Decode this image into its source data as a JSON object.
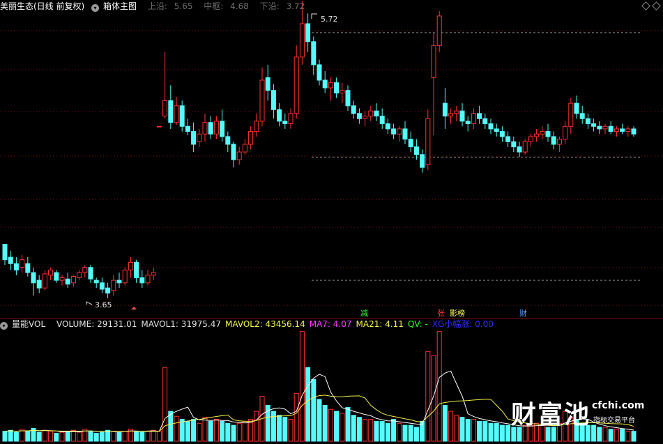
{
  "header": {
    "symbol": "美丽生态(日线 前复权)",
    "indicator": "箱体主图",
    "upper_label": "上沿:",
    "upper_value": "5.65",
    "mid_label": "中枢:",
    "mid_value": "4.68",
    "lower_label": "下沿:",
    "lower_value": "3.72"
  },
  "vol_header": {
    "name": "量能VOL",
    "items": [
      {
        "label": "VOLUME:",
        "value": "29131.01",
        "color": "#e0e0e0"
      },
      {
        "label": "MAVOL1:",
        "value": "31975.47",
        "color": "#e0e0e0"
      },
      {
        "label": "MAVOL2:",
        "value": "43456.14",
        "color": "#f5f54a"
      },
      {
        "label": "MA7:",
        "value": "4.07",
        "color": "#ff40ff"
      },
      {
        "label": "MA21:",
        "value": "4.11",
        "color": "#f5f54a"
      },
      {
        "label": "QV:",
        "value": "-",
        "color": "#30ff30"
      },
      {
        "label": "XG小幅涨:",
        "value": "0.00",
        "color": "#3030ff"
      }
    ]
  },
  "markers": [
    {
      "text": "减",
      "color": "#30ff30"
    },
    {
      "text": "张",
      "color": "#ff4040"
    },
    {
      "text": "影榜",
      "color": "#ffff60"
    },
    {
      "text": "财",
      "color": "#60a0ff"
    }
  ],
  "annotations": {
    "high": "5.72",
    "low": "3.65"
  },
  "watermark": {
    "logo": "财富池",
    "site": "cfchi.com",
    "tagline": "指标交易平台"
  },
  "colors": {
    "up": "#ff3232",
    "down": "#54fcfc",
    "grid": "#7a1010",
    "box": "#8a8a8a"
  },
  "chart_data": {
    "type": "candlestick",
    "x": "daily bars (approximate readings)",
    "price_levels": {
      "upper": 5.65,
      "mid": 4.68,
      "lower": 3.72
    },
    "ohlc": [
      [
        4.0,
        4.0,
        3.84,
        3.88
      ],
      [
        3.9,
        3.95,
        3.8,
        3.85
      ],
      [
        3.85,
        3.9,
        3.76,
        3.8
      ],
      [
        3.82,
        3.92,
        3.78,
        3.88
      ],
      [
        3.85,
        3.9,
        3.75,
        3.78
      ],
      [
        3.78,
        3.82,
        3.6,
        3.7
      ],
      [
        3.72,
        3.76,
        3.62,
        3.66
      ],
      [
        3.66,
        3.8,
        3.64,
        3.77
      ],
      [
        3.76,
        3.82,
        3.72,
        3.8
      ],
      [
        3.78,
        3.8,
        3.7,
        3.72
      ],
      [
        3.72,
        3.76,
        3.68,
        3.74
      ],
      [
        3.73,
        3.78,
        3.66,
        3.69
      ],
      [
        3.7,
        3.76,
        3.67,
        3.75
      ],
      [
        3.74,
        3.8,
        3.72,
        3.78
      ],
      [
        3.78,
        3.84,
        3.74,
        3.82
      ],
      [
        3.82,
        3.84,
        3.7,
        3.73
      ],
      [
        3.72,
        3.74,
        3.66,
        3.7
      ],
      [
        3.7,
        3.74,
        3.62,
        3.65
      ],
      [
        3.66,
        3.7,
        3.58,
        3.62
      ],
      [
        3.64,
        3.76,
        3.6,
        3.72
      ],
      [
        3.72,
        3.78,
        3.66,
        3.7
      ],
      [
        3.7,
        3.82,
        3.68,
        3.8
      ],
      [
        3.8,
        3.9,
        3.74,
        3.86
      ],
      [
        3.86,
        3.88,
        3.7,
        3.74
      ],
      [
        3.74,
        3.8,
        3.66,
        3.7
      ],
      [
        3.7,
        3.8,
        3.68,
        3.76
      ],
      [
        3.76,
        3.82,
        3.72,
        3.78
      ],
      [
        4.92,
        4.92,
        4.92,
        4.92
      ],
      [
        5.0,
        5.5,
        4.98,
        5.12
      ],
      [
        5.12,
        5.24,
        4.9,
        4.95
      ],
      [
        4.95,
        5.15,
        4.93,
        5.08
      ],
      [
        5.08,
        5.12,
        4.88,
        4.92
      ],
      [
        4.92,
        4.98,
        4.85,
        4.88
      ],
      [
        4.88,
        4.95,
        4.72,
        4.78
      ],
      [
        4.8,
        4.9,
        4.76,
        4.86
      ],
      [
        4.86,
        5.02,
        4.8,
        4.95
      ],
      [
        4.95,
        5.0,
        4.82,
        4.86
      ],
      [
        4.86,
        5.0,
        4.82,
        4.96
      ],
      [
        4.96,
        5.05,
        4.8,
        4.84
      ],
      [
        4.84,
        4.88,
        4.72,
        4.78
      ],
      [
        4.78,
        4.8,
        4.6,
        4.66
      ],
      [
        4.66,
        4.76,
        4.62,
        4.72
      ],
      [
        4.72,
        4.82,
        4.7,
        4.78
      ],
      [
        4.78,
        4.92,
        4.74,
        4.88
      ],
      [
        4.88,
        5.02,
        4.84,
        4.96
      ],
      [
        4.96,
        5.38,
        4.92,
        5.28
      ],
      [
        5.3,
        5.4,
        5.12,
        5.2
      ],
      [
        5.2,
        5.25,
        4.98,
        5.05
      ],
      [
        5.05,
        5.1,
        4.92,
        4.96
      ],
      [
        4.96,
        5.02,
        4.9,
        4.94
      ],
      [
        4.94,
        5.06,
        4.9,
        5.02
      ],
      [
        5.02,
        5.55,
        4.98,
        5.46
      ],
      [
        5.46,
        5.9,
        5.4,
        5.72
      ],
      [
        5.72,
        5.8,
        5.5,
        5.58
      ],
      [
        5.58,
        5.62,
        5.32,
        5.4
      ],
      [
        5.4,
        5.44,
        5.24,
        5.28
      ],
      [
        5.28,
        5.35,
        5.18,
        5.22
      ],
      [
        5.22,
        5.3,
        5.12,
        5.26
      ],
      [
        5.26,
        5.3,
        5.14,
        5.18
      ],
      [
        5.18,
        5.26,
        5.1,
        5.2
      ],
      [
        5.2,
        5.24,
        5.04,
        5.08
      ],
      [
        5.08,
        5.12,
        4.98,
        5.02
      ],
      [
        5.02,
        5.06,
        4.94,
        4.98
      ],
      [
        4.98,
        5.04,
        4.92,
        5.0
      ],
      [
        5.0,
        5.08,
        4.96,
        5.04
      ],
      [
        5.04,
        5.1,
        4.96,
        5.0
      ],
      [
        5.0,
        5.06,
        4.9,
        4.94
      ],
      [
        4.94,
        4.98,
        4.86,
        4.9
      ],
      [
        4.9,
        4.94,
        4.82,
        4.86
      ],
      [
        4.86,
        4.92,
        4.8,
        4.9
      ],
      [
        4.9,
        4.96,
        4.78,
        4.82
      ],
      [
        4.82,
        4.88,
        4.72,
        4.76
      ],
      [
        4.76,
        4.82,
        4.66,
        4.7
      ],
      [
        4.7,
        4.74,
        4.56,
        4.6
      ],
      [
        4.62,
        5.05,
        4.58,
        4.98
      ],
      [
        5.3,
        5.65,
        4.85,
        5.55
      ],
      [
        5.55,
        5.82,
        5.5,
        5.78
      ],
      [
        5.1,
        5.22,
        4.9,
        5.0
      ],
      [
        5.0,
        5.06,
        4.94,
        5.02
      ],
      [
        5.02,
        5.08,
        4.96,
        5.04
      ],
      [
        5.04,
        5.1,
        4.92,
        4.96
      ],
      [
        4.96,
        5.0,
        4.88,
        4.94
      ],
      [
        4.94,
        5.06,
        4.9,
        5.02
      ],
      [
        5.02,
        5.08,
        4.94,
        4.98
      ],
      [
        4.98,
        5.02,
        4.9,
        4.94
      ],
      [
        4.94,
        4.98,
        4.86,
        4.9
      ],
      [
        4.9,
        4.94,
        4.84,
        4.88
      ],
      [
        4.88,
        4.92,
        4.8,
        4.84
      ],
      [
        4.84,
        4.88,
        4.76,
        4.8
      ],
      [
        4.8,
        4.84,
        4.72,
        4.76
      ],
      [
        4.76,
        4.8,
        4.68,
        4.72
      ],
      [
        4.72,
        4.82,
        4.7,
        4.8
      ],
      [
        4.8,
        4.86,
        4.76,
        4.84
      ],
      [
        4.84,
        4.9,
        4.8,
        4.86
      ],
      [
        4.86,
        4.92,
        4.82,
        4.88
      ],
      [
        4.88,
        4.94,
        4.8,
        4.84
      ],
      [
        4.84,
        4.88,
        4.74,
        4.78
      ],
      [
        4.78,
        4.84,
        4.72,
        4.82
      ],
      [
        4.82,
        4.96,
        4.78,
        4.92
      ],
      [
        4.92,
        5.14,
        4.86,
        5.1
      ],
      [
        5.1,
        5.16,
        4.98,
        5.02
      ],
      [
        5.02,
        5.08,
        4.94,
        4.98
      ],
      [
        4.98,
        5.02,
        4.9,
        4.94
      ],
      [
        4.94,
        4.98,
        4.88,
        4.92
      ],
      [
        4.92,
        4.96,
        4.86,
        4.9
      ],
      [
        4.9,
        4.94,
        4.86,
        4.92
      ],
      [
        4.92,
        4.96,
        4.86,
        4.88
      ],
      [
        4.88,
        4.92,
        4.84,
        4.9
      ],
      [
        4.9,
        4.94,
        4.86,
        4.88
      ],
      [
        4.88,
        4.92,
        4.84,
        4.9
      ],
      [
        4.9,
        4.92,
        4.84,
        4.86
      ]
    ],
    "volume": [
      1.0,
      1.1,
      0.9,
      1.2,
      1.0,
      1.3,
      0.9,
      1.1,
      1.0,
      0.8,
      0.9,
      1.0,
      1.1,
      0.9,
      1.2,
      1.0,
      0.8,
      0.9,
      1.1,
      1.0,
      0.9,
      1.0,
      1.2,
      1.0,
      0.9,
      1.0,
      1.1,
      1.0,
      7.4,
      3.0,
      2.5,
      2.2,
      2.0,
      2.2,
      1.8,
      2.4,
      2.0,
      2.2,
      2.0,
      1.8,
      1.6,
      1.8,
      2.0,
      2.2,
      3.0,
      4.5,
      3.6,
      3.0,
      2.6,
      2.4,
      2.2,
      4.8,
      11.0,
      7.4,
      6.2,
      4.2,
      3.6,
      3.2,
      3.0,
      2.8,
      3.4,
      2.6,
      2.4,
      2.2,
      2.2,
      2.0,
      2.0,
      1.8,
      2.2,
      1.8,
      1.6,
      1.6,
      1.4,
      2.0,
      9.0,
      8.6,
      11.0,
      3.6,
      3.0,
      2.6,
      2.4,
      2.2,
      2.2,
      2.0,
      2.0,
      1.8,
      1.8,
      1.6,
      1.6,
      1.4,
      1.4,
      1.6,
      1.6,
      1.8,
      1.6,
      1.4,
      1.4,
      1.8,
      3.0,
      2.4,
      2.2,
      1.8,
      1.6,
      1.6,
      1.4,
      1.4,
      1.2,
      1.2,
      1.2,
      1.0,
      1.0
    ],
    "mavol1_line": "white",
    "mavol2_line": "yellow"
  }
}
